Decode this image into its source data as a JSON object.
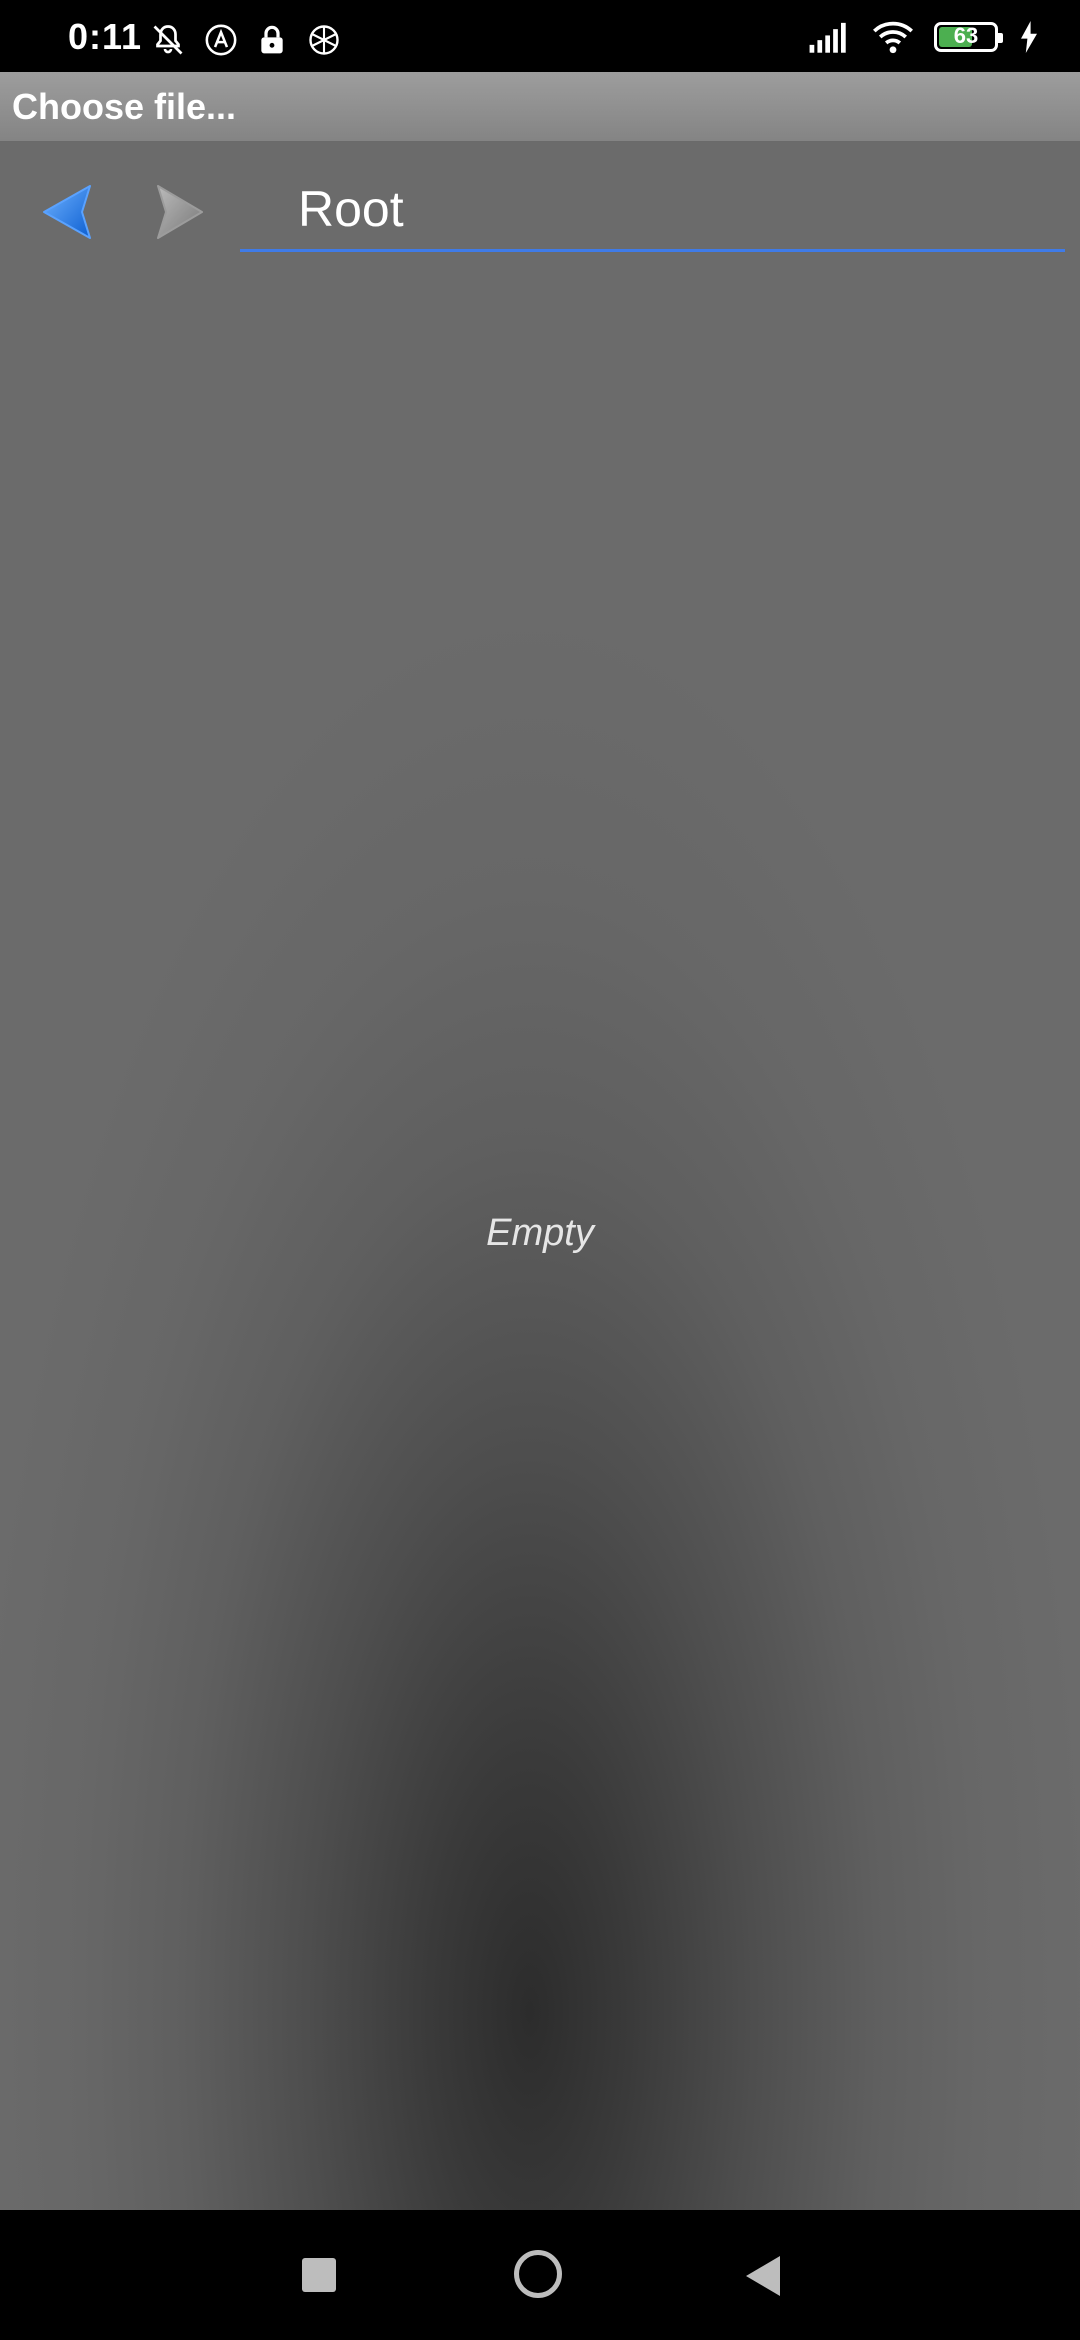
{
  "status_bar": {
    "time": "0:11",
    "battery_level": 63,
    "battery_text": "63",
    "battery_color": "#4caf50",
    "left_icons": [
      "bell-off-icon",
      "accessibility-a-icon",
      "lock-icon",
      "app-notification-icon"
    ],
    "right_icons": [
      "signal-icon",
      "wifi-icon",
      "battery-icon",
      "charging-bolt-icon"
    ]
  },
  "title_bar": {
    "title": "Choose file..."
  },
  "navigation": {
    "back_icon": "arrow-left-icon",
    "forward_icon": "arrow-right-icon",
    "back_color": "#1976d2",
    "forward_color": "#9e9e9e",
    "current_path": "Root",
    "underline_color": "#3f7be8"
  },
  "file_list": {
    "empty_text": "Empty"
  },
  "system_nav": {
    "buttons": [
      "recent-apps-button",
      "home-button",
      "back-button"
    ]
  }
}
